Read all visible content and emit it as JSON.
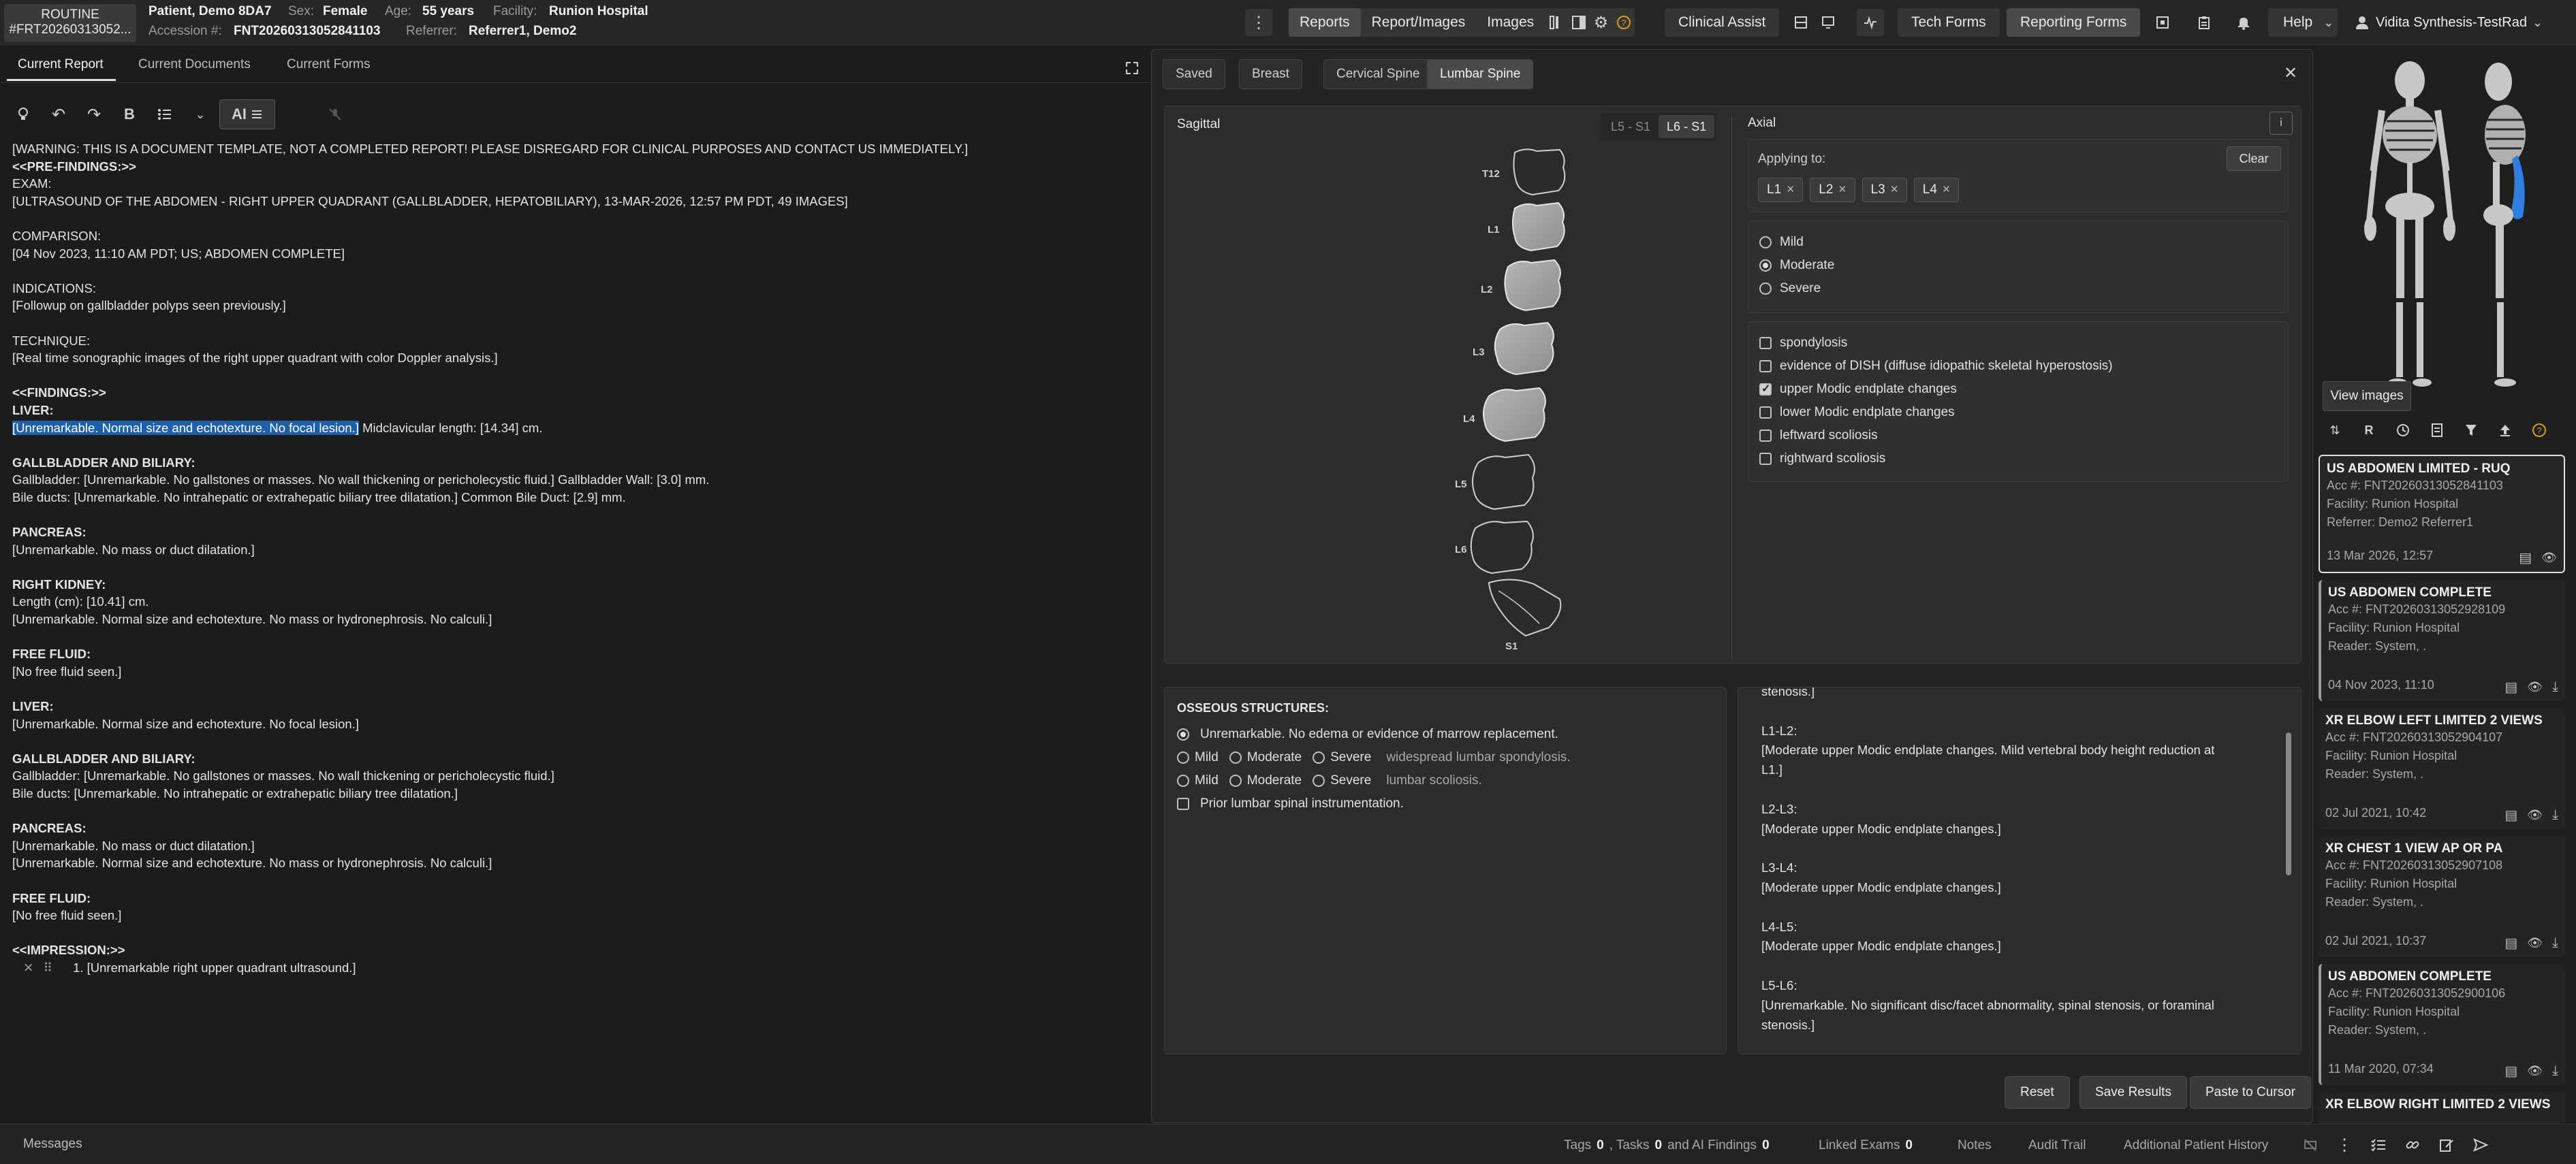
{
  "header": {
    "priority": "ROUTINE",
    "order_id": "#FRT20260313052...",
    "patient_name": "Patient, Demo 8DA7",
    "sex_label": "Sex:",
    "sex": "Female",
    "age_label": "Age:",
    "age": "55 years",
    "facility_label": "Facility:",
    "facility": "Runion Hospital",
    "accession_label": "Accession #:",
    "accession": "FNT20260313052841103",
    "referrer_label": "Referrer:",
    "referrer": "Referrer1, Demo2"
  },
  "nav": {
    "reports": "Reports",
    "report_images": "Report/Images",
    "images": "Images",
    "clinical_assist": "Clinical Assist",
    "tech_forms": "Tech Forms",
    "reporting_forms": "Reporting Forms",
    "help": "Help",
    "user": "Vidita Synthesis-TestRad"
  },
  "left_tabs": {
    "current_report": "Current Report",
    "current_documents": "Current Documents",
    "current_forms": "Current Forms"
  },
  "editor_toolbar": {
    "ai_label": "AI"
  },
  "report": {
    "lines": [
      {
        "t": "[WARNING: THIS IS A DOCUMENT TEMPLATE, NOT A COMPLETED REPORT! PLEASE DISREGARD FOR CLINICAL PURPOSES AND CONTACT US IMMEDIATELY.]",
        "b": false
      },
      {
        "t": "<<PRE-FINDINGS:>>",
        "b": true
      },
      {
        "t": "EXAM:",
        "b": false
      },
      {
        "t": "[ULTRASOUND OF THE ABDOMEN - RIGHT UPPER QUADRANT (GALLBLADDER, HEPATOBILIARY), 13-MAR-2026, 12:57 PM PDT, 49 IMAGES]",
        "b": false
      },
      {
        "t": "",
        "b": false
      },
      {
        "t": "COMPARISON:",
        "b": false
      },
      {
        "t": "[04 Nov 2023, 11:10 AM PDT; US; ABDOMEN COMPLETE]",
        "b": false
      },
      {
        "t": "",
        "b": false
      },
      {
        "t": "INDICATIONS:",
        "b": false
      },
      {
        "t": "[Followup on gallbladder polyps seen previously.]",
        "b": false
      },
      {
        "t": "",
        "b": false
      },
      {
        "t": "TECHNIQUE:",
        "b": false
      },
      {
        "t": "[Real time sonographic images of the right upper quadrant with color Doppler analysis.]",
        "b": false
      },
      {
        "t": "",
        "b": false
      },
      {
        "t": "<<FINDINGS:>>",
        "b": true
      },
      {
        "t": "LIVER:",
        "b": true
      },
      {
        "t": "HIGHLIGHT",
        "b": false
      },
      {
        "t": "",
        "b": false
      },
      {
        "t": "GALLBLADDER AND BILIARY:",
        "b": true
      },
      {
        "t": "Gallbladder: [Unremarkable. No gallstones or masses. No wall thickening or pericholecystic fluid.] Gallbladder Wall: [3.0] mm.",
        "b": false
      },
      {
        "t": "Bile ducts: [Unremarkable. No intrahepatic or extrahepatic biliary tree dilatation.] Common Bile Duct: [2.9] mm.",
        "b": false
      },
      {
        "t": "",
        "b": false
      },
      {
        "t": "PANCREAS:",
        "b": true
      },
      {
        "t": "[Unremarkable. No mass or duct dilatation.]",
        "b": false
      },
      {
        "t": "",
        "b": false
      },
      {
        "t": "RIGHT KIDNEY:",
        "b": true
      },
      {
        "t": "Length (cm): [10.41] cm.",
        "b": false
      },
      {
        "t": "[Unremarkable. Normal size and echotexture. No mass or hydronephrosis. No calculi.]",
        "b": false
      },
      {
        "t": "",
        "b": false
      },
      {
        "t": "FREE FLUID:",
        "b": true
      },
      {
        "t": "[No free fluid seen.]",
        "b": false
      },
      {
        "t": "",
        "b": false
      },
      {
        "t": "LIVER:",
        "b": true
      },
      {
        "t": "[Unremarkable. Normal size and echotexture. No focal lesion.]",
        "b": false
      },
      {
        "t": "",
        "b": false
      },
      {
        "t": "GALLBLADDER AND BILIARY:",
        "b": true
      },
      {
        "t": "Gallbladder: [Unremarkable. No gallstones or masses. No wall thickening or pericholecystic fluid.]",
        "b": false
      },
      {
        "t": "Bile ducts: [Unremarkable. No intrahepatic or extrahepatic biliary tree dilatation.]",
        "b": false
      },
      {
        "t": "",
        "b": false
      },
      {
        "t": "PANCREAS:",
        "b": true
      },
      {
        "t": "[Unremarkable. No mass or duct dilatation.]",
        "b": false
      },
      {
        "t": "[Unremarkable. Normal size and echotexture. No mass or hydronephrosis. No calculi.]",
        "b": false
      },
      {
        "t": "",
        "b": false
      },
      {
        "t": "FREE FLUID:",
        "b": true
      },
      {
        "t": "[No free fluid seen.]",
        "b": false
      },
      {
        "t": "",
        "b": false
      },
      {
        "t": "<<IMPRESSION:>>",
        "b": true
      }
    ],
    "liver_highlight": "[Unremarkable. Normal size and echotexture. No focal lesion.]",
    "liver_rest": " Midclavicular length: [14.34] cm.",
    "impression_item": "1. [Unremarkable right upper quadrant ultrasound.]"
  },
  "form": {
    "tabs": [
      "Saved",
      "Breast",
      "Cervical Spine",
      "Lumbar Spine"
    ],
    "active_tab": "Lumbar Spine",
    "sagittal_title": "Sagittal",
    "seg_options": [
      "L5 - S1",
      "L6 - S1"
    ],
    "vertebra_labels": [
      "T12",
      "L1",
      "L2",
      "L3",
      "L4",
      "L5",
      "L6",
      "S1"
    ],
    "axial_title": "Axial",
    "info_glyph": "i",
    "applying_to": "Applying to:",
    "clear": "Clear",
    "chips": [
      "L1",
      "L2",
      "L3",
      "L4"
    ],
    "severity": [
      "Mild",
      "Moderate",
      "Severe"
    ],
    "severity_selected": "Moderate",
    "findings_checks": [
      {
        "label": "spondylosis",
        "checked": false
      },
      {
        "label": "evidence of DISH (diffuse idiopathic skeletal hyperostosis)",
        "checked": false
      },
      {
        "label": "upper Modic endplate changes",
        "checked": true
      },
      {
        "label": "lower Modic endplate changes",
        "checked": false
      },
      {
        "label": "leftward scoliosis",
        "checked": false
      },
      {
        "label": "rightward scoliosis",
        "checked": false
      }
    ],
    "osseous_title": "OSSEOUS STRUCTURES:",
    "osseous_unremarkable": "Unremarkable. No edema or evidence of marrow replacement.",
    "osseous_row1_suffix": "widespread lumbar spondylosis.",
    "osseous_row2_suffix": "lumbar scoliosis.",
    "osseous_prior": "Prior lumbar spinal instrumentation.",
    "findings_text": "stenosis.]\n\nL1-L2:\n[Moderate upper Modic endplate changes. Mild vertebral body height reduction at\nL1.]\n\nL2-L3:\n[Moderate upper Modic endplate changes.]\n\nL3-L4:\n[Moderate upper Modic endplate changes.]\n\nL4-L5:\n[Moderate upper Modic endplate changes.]\n\nL5-L6:\n[Unremarkable. No significant disc/facet abnormality, spinal stenosis, or foraminal\nstenosis.]",
    "reset": "Reset",
    "save_results": "Save Results",
    "paste_to_cursor": "Paste to Cursor"
  },
  "right_panel": {
    "view_images": "View images",
    "exams": [
      {
        "title": "US ABDOMEN LIMITED - RUQ",
        "acc": "Acc #: FNT20260313052841103",
        "facility": "Facility: Runion Hospital",
        "person": "Referrer: Demo2 Referrer1",
        "date": "13 Mar 2026, 12:57"
      },
      {
        "title": "US ABDOMEN COMPLETE",
        "acc": "Acc #: FNT20260313052928109",
        "facility": "Facility: Runion Hospital",
        "person": "Reader: System, .",
        "date": "04 Nov 2023, 11:10"
      },
      {
        "title": "XR ELBOW LEFT LIMITED 2 VIEWS",
        "acc": "Acc #: FNT20260313052904107",
        "facility": "Facility: Runion Hospital",
        "person": "Reader: System, .",
        "date": "02 Jul 2021, 10:42"
      },
      {
        "title": "XR CHEST 1 VIEW AP OR PA",
        "acc": "Acc #: FNT20260313052907108",
        "facility": "Facility: Runion Hospital",
        "person": "Reader: System, .",
        "date": "02 Jul 2021, 10:37"
      },
      {
        "title": "US ABDOMEN COMPLETE",
        "acc": "Acc #: FNT20260313052900106",
        "facility": "Facility: Runion Hospital",
        "person": "Reader: System, .",
        "date": "11 Mar 2020, 07:34"
      },
      {
        "title": "XR ELBOW RIGHT LIMITED 2 VIEWS",
        "acc": "",
        "facility": "",
        "person": "",
        "date": ""
      }
    ]
  },
  "bottom": {
    "messages": "Messages",
    "tags": "Tags",
    "tags_count": "0",
    "tasks": ", Tasks",
    "tasks_count": "0",
    "ai_findings": "and AI Findings",
    "ai_count": "0",
    "linked_exams": "Linked Exams",
    "linked_count": "0",
    "notes": "Notes",
    "audit_trail": "Audit Trail",
    "additional_history": "Additional Patient History"
  }
}
